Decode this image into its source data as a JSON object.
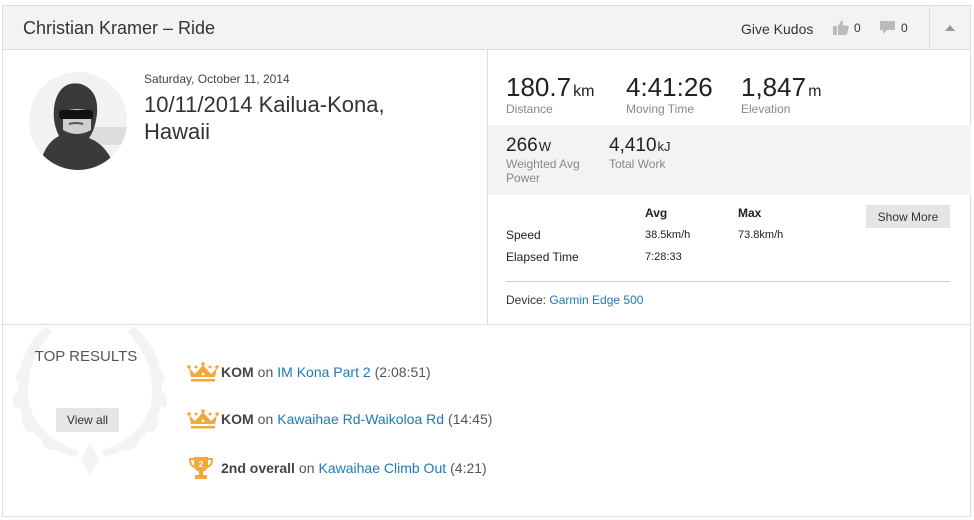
{
  "header": {
    "title": "Christian Kramer – Ride",
    "give_kudos": "Give Kudos",
    "kudos_count": "0",
    "comment_count": "0"
  },
  "activity": {
    "date": "Saturday, October 11, 2014",
    "name": "10/11/2014 Kailua-Kona, Hawaii"
  },
  "primary_stats": [
    {
      "value": "180.7",
      "unit": "km",
      "label": "Distance"
    },
    {
      "value": "4:41:26",
      "unit": "",
      "label": "Moving Time"
    },
    {
      "value": "1,847",
      "unit": "m",
      "label": "Elevation"
    }
  ],
  "secondary_stats": [
    {
      "value": "266",
      "unit": "W",
      "label": "Weighted Avg Power"
    },
    {
      "value": "4,410",
      "unit": "kJ",
      "label": "Total Work"
    }
  ],
  "more_stats": {
    "col_avg": "Avg",
    "col_max": "Max",
    "rows": [
      {
        "label": "Speed",
        "avg": "38.5km/h",
        "max": "73.8km/h"
      },
      {
        "label": "Elapsed Time",
        "avg": "7:28:33",
        "max": ""
      }
    ],
    "show_more": "Show More",
    "device_label": "Device:",
    "device_name": "Garmin Edge 500"
  },
  "top_results": {
    "title": "TOP RESULTS",
    "view_all": "View all",
    "items": [
      {
        "icon": "crown-icon",
        "achievement": "KOM",
        "on": "on",
        "segment": "IM Kona Part 2",
        "time": "(2:08:51)"
      },
      {
        "icon": "crown-icon",
        "achievement": "KOM",
        "on": "on",
        "segment": "Kawaihae Rd-Waikoloa Rd",
        "time": "(14:45)"
      },
      {
        "icon": "trophy-icon",
        "rank": "2",
        "achievement": "2nd overall",
        "on": "on",
        "segment": "Kawaihae Climb Out",
        "time": "(4:21)"
      }
    ]
  },
  "colors": {
    "link": "#1d7ab8",
    "award": "#f2a93b",
    "header_bg": "#f3f3f3",
    "border": "#dddddd"
  }
}
